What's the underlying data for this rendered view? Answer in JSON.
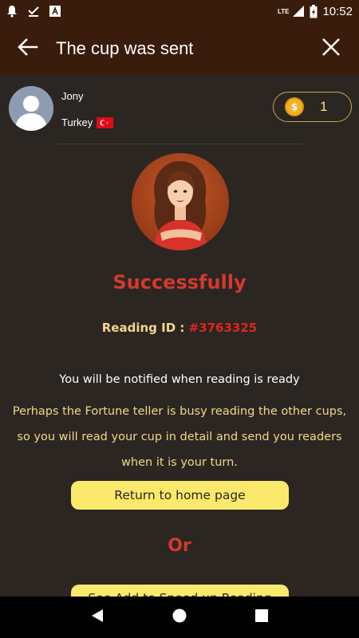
{
  "status_bar": {
    "time": "10:52",
    "network": "LTE",
    "icons": [
      "notification-bell-icon",
      "download-done-icon",
      "font-app-icon",
      "signal-icon",
      "battery-icon"
    ]
  },
  "app_bar": {
    "title": "The cup was sent",
    "back_icon": "arrow-back-icon",
    "close_icon": "close-icon"
  },
  "user": {
    "name": "Jony",
    "country": "Turkey",
    "flag": "turkey-flag-icon"
  },
  "coins": {
    "count": "1",
    "icon": "coin-icon",
    "symbol": "$"
  },
  "result": {
    "title": "Successfully",
    "reading_id_label": "Reading ID :",
    "reading_id_value": "#3763325",
    "notice": "You will be notified when reading is ready",
    "explain_lines": [
      "Perhaps the Fortune teller is busy reading the other cups,",
      "so you will read your cup in detail and send you readers",
      "when it is your turn."
    ]
  },
  "buttons": {
    "home": "Return to home page",
    "or": "Or",
    "second": "See Add to Speed up Reading"
  },
  "colors": {
    "app_bar": "#3a1c0c",
    "background": "#2b2622",
    "accent_red": "#d23a2c",
    "accent_yellow": "#fbe96d",
    "gold_text": "#f2d88a"
  }
}
